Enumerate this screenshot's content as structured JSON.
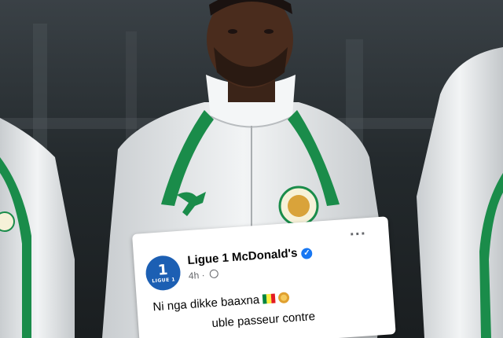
{
  "post": {
    "page_name": "Ligue 1 McDonald's",
    "time": "4h",
    "meta_separator": "·",
    "avatar_number": "1",
    "avatar_text": "LIGUE 1",
    "line1": "Ni nga dikke baaxna",
    "line2_visible": "uble passeur contre",
    "flag_colors": [
      "#00853f",
      "#fdef42",
      "#e31b23"
    ],
    "more_icon": "more-horizontal-icon",
    "verified_icon": "verified-badge-icon"
  },
  "photo": {
    "subject": "footballer in white and green Senegal jacket",
    "colors": {
      "jacket": "#e9ecee",
      "trim": "#1a8c4a",
      "background": "#2a3034"
    }
  }
}
